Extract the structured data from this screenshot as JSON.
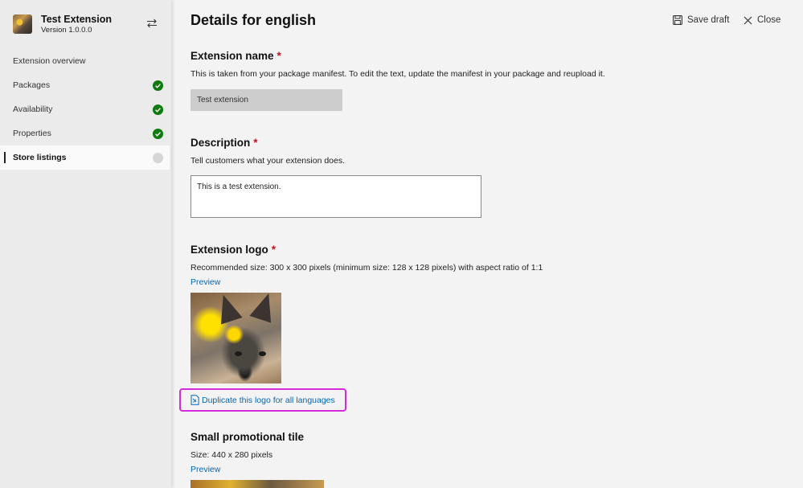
{
  "app": {
    "title": "Test Extension",
    "version": "Version 1.0.0.0"
  },
  "sidebar": {
    "items": [
      {
        "label": "Extension overview",
        "status": "none"
      },
      {
        "label": "Packages",
        "status": "complete"
      },
      {
        "label": "Availability",
        "status": "complete"
      },
      {
        "label": "Properties",
        "status": "complete"
      },
      {
        "label": "Store listings",
        "status": "pending"
      }
    ]
  },
  "header": {
    "title": "Details for english",
    "save_label": "Save draft",
    "close_label": "Close"
  },
  "extension_name": {
    "title": "Extension name",
    "required_mark": "*",
    "help": "This is taken from your package manifest. To edit the text, update the manifest in your package and reupload it.",
    "value": "Test extension"
  },
  "description": {
    "title": "Description",
    "required_mark": "*",
    "help": "Tell customers what your extension does.",
    "value": "This is a test extension."
  },
  "extension_logo": {
    "title": "Extension logo",
    "required_mark": "*",
    "help": "Recommended size: 300 x 300 pixels (minimum size: 128 x 128 pixels) with aspect ratio of 1:1",
    "preview_label": "Preview",
    "duplicate_label": "Duplicate this logo for all languages"
  },
  "small_tile": {
    "title": "Small promotional tile",
    "help": "Size: 440 x 280 pixels",
    "preview_label": "Preview"
  },
  "colors": {
    "accent": "#0067b8",
    "complete": "#107c10",
    "required": "#c50f1f",
    "highlight": "#d52bdc"
  }
}
